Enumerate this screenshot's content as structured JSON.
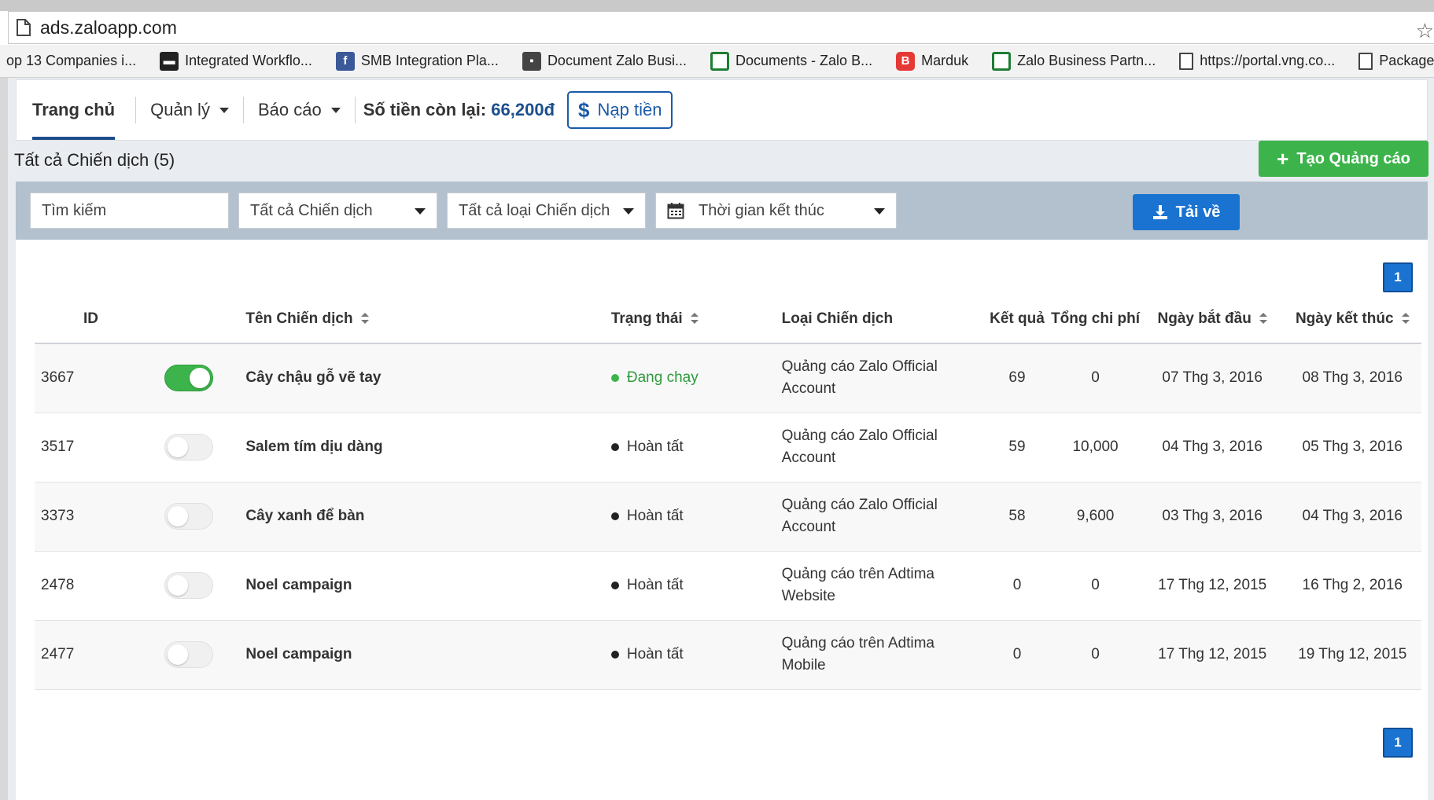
{
  "browser": {
    "url": "ads.zaloapp.com",
    "bookmarks": [
      {
        "label": "op 13 Companies i...",
        "icon": "none"
      },
      {
        "label": "Integrated Workflo...",
        "icon": "dark-logo-icon"
      },
      {
        "label": "SMB Integration Pla...",
        "icon": "facebook-icon"
      },
      {
        "label": "Document Zalo Busi...",
        "icon": "folder-icon"
      },
      {
        "label": "Documents - Zalo B...",
        "icon": "spreadsheet-icon"
      },
      {
        "label": "Marduk",
        "icon": "red-b-icon"
      },
      {
        "label": "Zalo Business Partn...",
        "icon": "spreadsheet-icon"
      },
      {
        "label": "https://portal.vng.co...",
        "icon": "page-icon"
      },
      {
        "label": "Package",
        "icon": "page-icon"
      }
    ]
  },
  "nav": {
    "home": "Trang chủ",
    "manage": "Quản lý",
    "report": "Báo cáo",
    "balance_label": "Số tiền còn lại:",
    "balance_value": "66,200đ",
    "topup_symbol": "$",
    "topup_label": "Nạp tiền"
  },
  "section": {
    "title": "Tất cả Chiến dịch (5)",
    "create_symbol": "+",
    "create_label": "Tạo Quảng cáo"
  },
  "filters": {
    "search_placeholder": "Tìm kiếm",
    "campaign_select": "Tất cả Chiến dịch",
    "type_select": "Tất cả loại Chiến dịch",
    "date_select": "Thời gian kết thúc",
    "download_label": "Tải về"
  },
  "pagination": {
    "current": "1"
  },
  "table": {
    "headers": {
      "id": "ID",
      "name": "Tên Chiến dịch",
      "status": "Trạng thái",
      "type": "Loại Chiến dịch",
      "result": "Kết quả",
      "cost": "Tổng chi phí",
      "start": "Ngày bắt đầu",
      "end": "Ngày kết thúc"
    },
    "rows": [
      {
        "id": "3667",
        "active": true,
        "name": "Cây chậu gỗ vẽ tay",
        "status": "Đang chạy",
        "type_line1": "Quảng cáo Zalo Official",
        "type_line2": "Account",
        "result": "69",
        "cost": "0",
        "start": "07 Thg 3, 2016",
        "end": "08 Thg 3, 2016"
      },
      {
        "id": "3517",
        "active": false,
        "name": "Salem tím dịu dàng",
        "status": "Hoàn tất",
        "type_line1": "Quảng cáo Zalo Official",
        "type_line2": "Account",
        "result": "59",
        "cost": "10,000",
        "start": "04 Thg 3, 2016",
        "end": "05 Thg 3, 2016"
      },
      {
        "id": "3373",
        "active": false,
        "name": "Cây xanh để bàn",
        "status": "Hoàn tất",
        "type_line1": "Quảng cáo Zalo Official",
        "type_line2": "Account",
        "result": "58",
        "cost": "9,600",
        "start": "03 Thg 3, 2016",
        "end": "04 Thg 3, 2016"
      },
      {
        "id": "2478",
        "active": false,
        "name": "Noel campaign",
        "status": "Hoàn tất",
        "type_line1": "Quảng cáo trên Adtima",
        "type_line2": "Website",
        "result": "0",
        "cost": "0",
        "start": "17 Thg 12, 2015",
        "end": "16 Thg 2, 2016"
      },
      {
        "id": "2477",
        "active": false,
        "name": "Noel campaign",
        "status": "Hoàn tất",
        "type_line1": "Quảng cáo trên Adtima",
        "type_line2": "Mobile",
        "result": "0",
        "cost": "0",
        "start": "17 Thg 12, 2015",
        "end": "19 Thg 12, 2015"
      }
    ]
  },
  "colors": {
    "accent_blue": "#1a73d1",
    "success_green": "#3cb44b",
    "balance_blue": "#1a4f8c"
  }
}
